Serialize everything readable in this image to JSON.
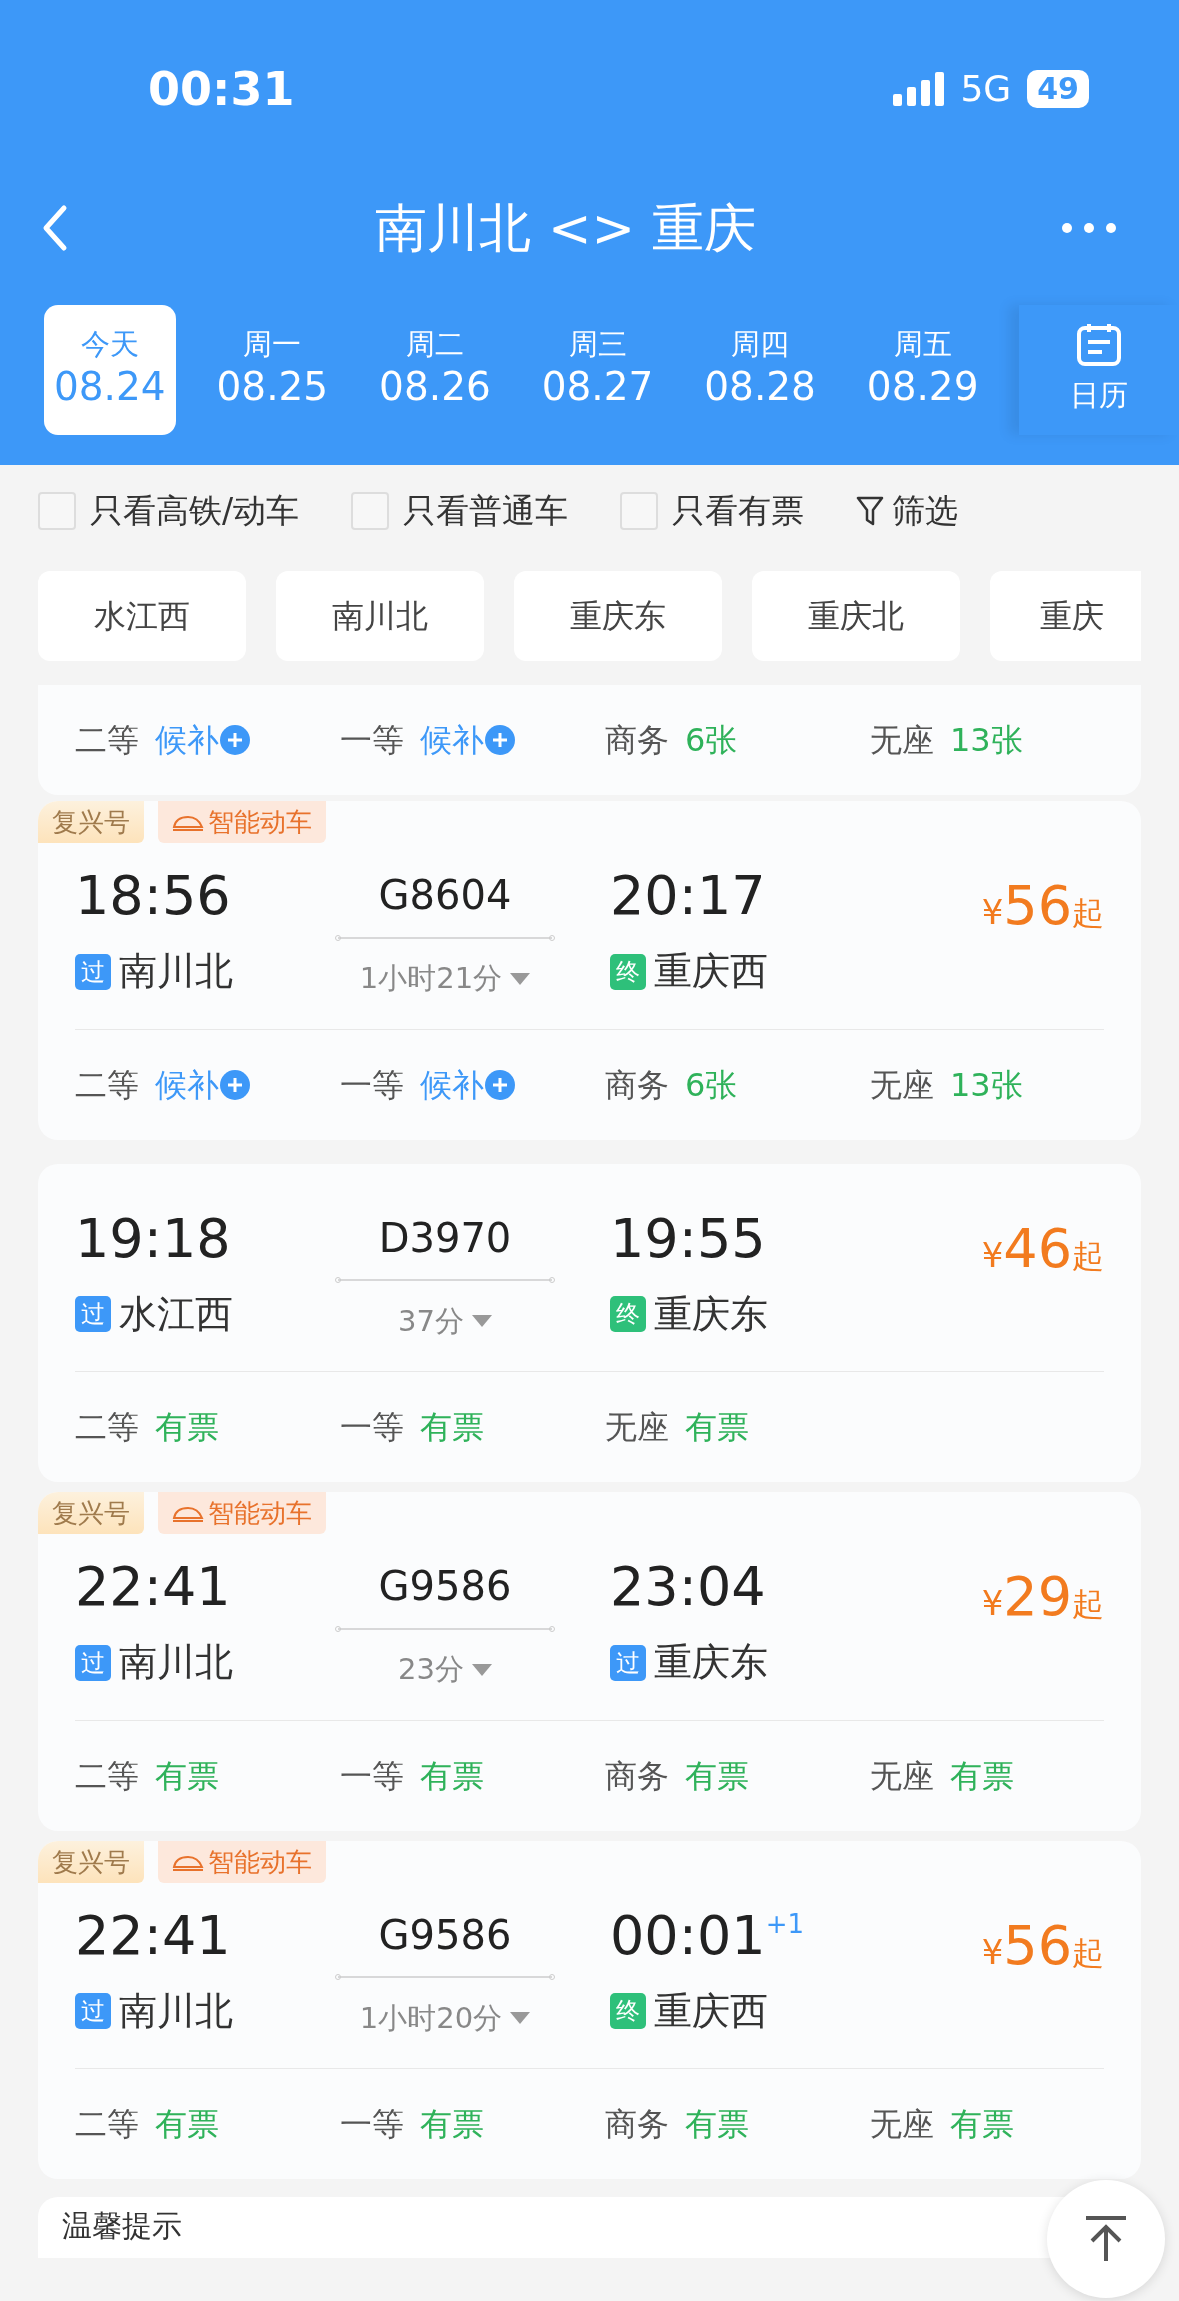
{
  "status_bar": {
    "time": "00:31",
    "network": "5G",
    "battery": "49"
  },
  "nav": {
    "title": "南川北 <> 重庆"
  },
  "dates": [
    {
      "weekday": "今天",
      "date": "08.24",
      "selected": true
    },
    {
      "weekday": "周一",
      "date": "08.25",
      "selected": false
    },
    {
      "weekday": "周二",
      "date": "08.26",
      "selected": false
    },
    {
      "weekday": "周三",
      "date": "08.27",
      "selected": false
    },
    {
      "weekday": "周四",
      "date": "08.28",
      "selected": false
    },
    {
      "weekday": "周五",
      "date": "08.29",
      "selected": false
    }
  ],
  "calendar_label": "日历",
  "filters": [
    {
      "label": "只看高铁/动车",
      "checked": false
    },
    {
      "label": "只看普通车",
      "checked": false
    },
    {
      "label": "只看有票",
      "checked": false
    }
  ],
  "filter_button": "筛选",
  "stations": [
    "水江西",
    "南川北",
    "重庆东",
    "重庆北",
    "重庆"
  ],
  "trains": [
    {
      "partial": true,
      "seats": [
        {
          "class": "二等",
          "status": "候补",
          "kind": "waitlist"
        },
        {
          "class": "一等",
          "status": "候补",
          "kind": "waitlist"
        },
        {
          "class": "商务",
          "status": "6张",
          "kind": "count"
        },
        {
          "class": "无座",
          "status": "13张",
          "kind": "count"
        }
      ]
    },
    {
      "partial": false,
      "badges": [
        {
          "label": "复兴号",
          "kind": "brand"
        },
        {
          "label": "智能动车",
          "kind": "smart"
        }
      ],
      "depart": "18:56",
      "number": "G8604",
      "arrive": "20:17",
      "duration": "1小时21分",
      "from": {
        "tag": "过",
        "kind": "pass",
        "name": "南川北"
      },
      "to": {
        "tag": "终",
        "kind": "terminal",
        "name": "重庆西"
      },
      "currency": "¥",
      "price": "56",
      "price_suffix": "起",
      "seats": [
        {
          "class": "二等",
          "status": "候补",
          "kind": "waitlist"
        },
        {
          "class": "一等",
          "status": "候补",
          "kind": "waitlist"
        },
        {
          "class": "商务",
          "status": "6张",
          "kind": "count"
        },
        {
          "class": "无座",
          "status": "13张",
          "kind": "count"
        }
      ]
    },
    {
      "partial": false,
      "depart": "19:18",
      "number": "D3970",
      "arrive": "19:55",
      "duration": "37分",
      "from": {
        "tag": "过",
        "kind": "pass",
        "name": "水江西"
      },
      "to": {
        "tag": "终",
        "kind": "terminal",
        "name": "重庆东"
      },
      "currency": "¥",
      "price": "46",
      "price_suffix": "起",
      "seats": [
        {
          "class": "二等",
          "status": "有票",
          "kind": "available"
        },
        {
          "class": "一等",
          "status": "有票",
          "kind": "available"
        },
        {
          "class": "无座",
          "status": "有票",
          "kind": "available"
        }
      ]
    },
    {
      "partial": false,
      "badges": [
        {
          "label": "复兴号",
          "kind": "brand"
        },
        {
          "label": "智能动车",
          "kind": "smart"
        }
      ],
      "depart": "22:41",
      "number": "G9586",
      "arrive": "23:04",
      "duration": "23分",
      "from": {
        "tag": "过",
        "kind": "pass",
        "name": "南川北"
      },
      "to": {
        "tag": "过",
        "kind": "pass",
        "name": "重庆东"
      },
      "currency": "¥",
      "price": "29",
      "price_suffix": "起",
      "seats": [
        {
          "class": "二等",
          "status": "有票",
          "kind": "available"
        },
        {
          "class": "一等",
          "status": "有票",
          "kind": "available"
        },
        {
          "class": "商务",
          "status": "有票",
          "kind": "available"
        },
        {
          "class": "无座",
          "status": "有票",
          "kind": "available"
        }
      ]
    },
    {
      "partial": false,
      "badges": [
        {
          "label": "复兴号",
          "kind": "brand"
        },
        {
          "label": "智能动车",
          "kind": "smart"
        }
      ],
      "depart": "22:41",
      "number": "G9586",
      "arrive": "00:01",
      "next_day": "+1",
      "duration": "1小时20分",
      "from": {
        "tag": "过",
        "kind": "pass",
        "name": "南川北"
      },
      "to": {
        "tag": "终",
        "kind": "terminal",
        "name": "重庆西"
      },
      "currency": "¥",
      "price": "56",
      "price_suffix": "起",
      "seats": [
        {
          "class": "二等",
          "status": "有票",
          "kind": "available"
        },
        {
          "class": "一等",
          "status": "有票",
          "kind": "available"
        },
        {
          "class": "商务",
          "status": "有票",
          "kind": "available"
        },
        {
          "class": "无座",
          "status": "有票",
          "kind": "available"
        }
      ]
    }
  ],
  "tips": {
    "title": "温馨提示"
  }
}
